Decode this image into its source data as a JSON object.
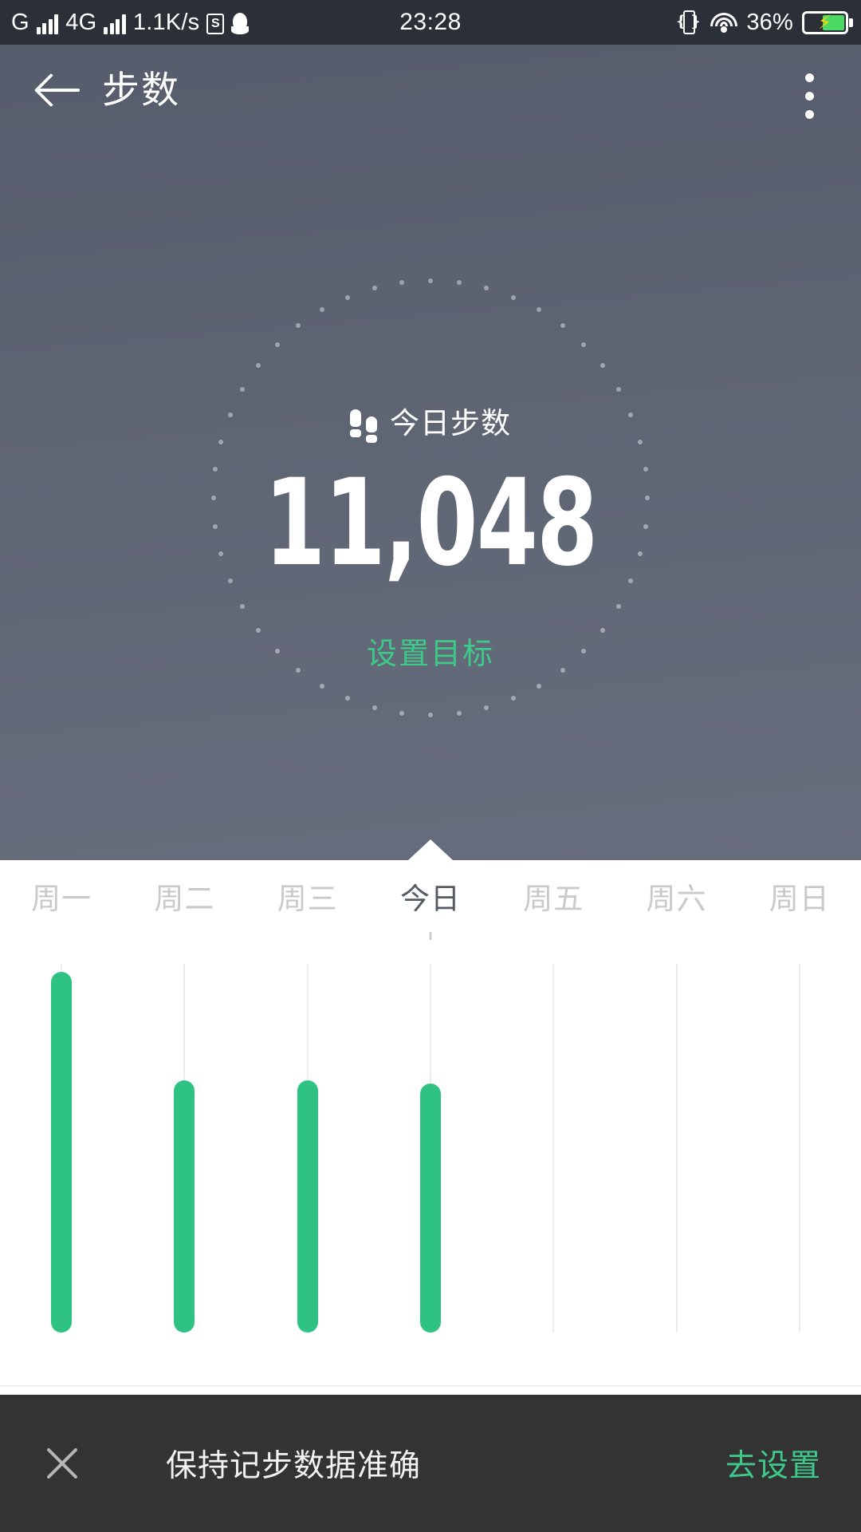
{
  "status_bar": {
    "carrier_label": "G",
    "network_type": "4G",
    "data_rate": "1.1K/s",
    "app_icon_s": "S",
    "qq_icon": "qq-icon",
    "time": "23:28",
    "vibrate_icon": "vibrate-icon",
    "wifi_icon": "wifi-icon",
    "battery_percent": "36%",
    "battery_charging": true,
    "background": "#2b2f38"
  },
  "app_bar": {
    "back_icon": "back-arrow-icon",
    "title": "步数",
    "overflow_icon": "overflow-menu-icon"
  },
  "hero": {
    "footprints_icon": "footprints-icon",
    "today_label": "今日步数",
    "steps_value": "11,048",
    "goal_link": "设置目标",
    "accent_color": "#3ec98a",
    "background_color": "#5d6472",
    "ring_dots": 48
  },
  "chart_data": {
    "type": "bar",
    "title": "",
    "xlabel": "",
    "ylabel": "",
    "categories": [
      "周一",
      "周二",
      "周三",
      "今日",
      "周五",
      "周六",
      "周日"
    ],
    "values": [
      11048,
      7400,
      7400,
      7200,
      0,
      0,
      0
    ],
    "active_index": 3,
    "bar_color": "#2ec283",
    "track_color": "#ececec",
    "grid": false,
    "legend": "none",
    "ylim": [
      0,
      11048
    ],
    "bar_heights_pct": [
      100,
      70,
      70,
      69,
      0,
      0,
      0
    ]
  },
  "banner": {
    "close_icon": "close-icon",
    "message": "保持记步数据准确",
    "action_label": "去设置",
    "background": "#333333",
    "action_color": "#3ec98a"
  }
}
